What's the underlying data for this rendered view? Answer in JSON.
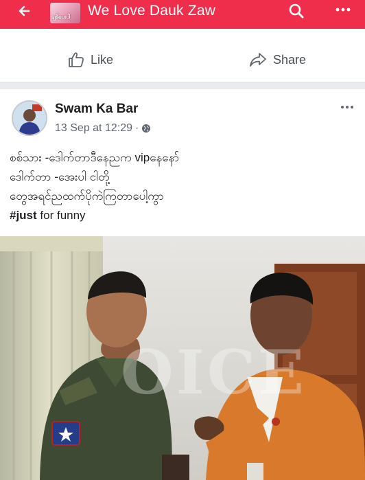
{
  "header": {
    "group_name": "We Love Dauk Zaw",
    "group_avatar_text": "ချစ်ပေးပါ",
    "bar_color": "#ee2e4a"
  },
  "actions": {
    "like_label": "Like",
    "share_label": "Share"
  },
  "post": {
    "author": "Swam Ka Bar",
    "timestamp": "13 Sep at 12:29",
    "audience_icon": "globe-icon",
    "lines": [
      "စစ်သား -ဒေါက်တာဒီနေညက vipနေနော်",
      "ဒေါက်တာ -အေးပါ ငါတို့",
      "တွေအရင်ညထက်ပိုကဲကြတာပေါ့ကွာ"
    ],
    "hashtag": "#just",
    "last_line_rest": " for funny",
    "photo_watermark": "OICE"
  },
  "icons": {
    "back": "arrow-left-icon",
    "search": "search-icon",
    "more": "more-dots-icon",
    "like": "thumbs-up-icon",
    "share": "share-arrow-icon"
  }
}
